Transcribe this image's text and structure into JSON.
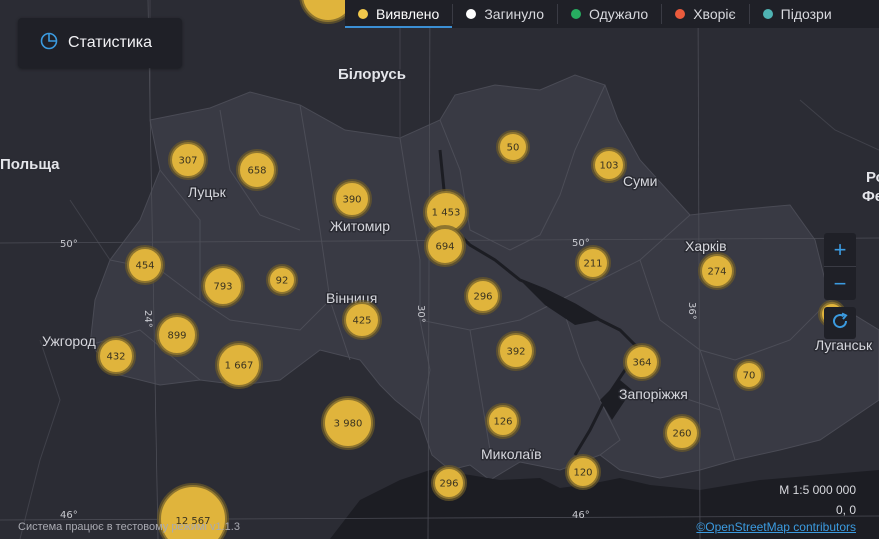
{
  "stats_button": {
    "label": "Статистика",
    "icon": "pie-chart-icon"
  },
  "tabs": [
    {
      "label": "Виявлено",
      "color": "#f2c94c",
      "active": true
    },
    {
      "label": "Загинуло",
      "color": "#ffffff",
      "active": false
    },
    {
      "label": "Одужало",
      "color": "#27ae60",
      "active": false
    },
    {
      "label": "Хворіє",
      "color": "#eb5b3c",
      "active": false
    },
    {
      "label": "Підозри",
      "color": "#4fb3b3",
      "active": false
    }
  ],
  "countries": {
    "belarus": "Білорусь",
    "poland": "Польща",
    "russia_partial_top": "Ро",
    "russia_partial_bottom": "Фе"
  },
  "cities": {
    "lutsk": "Луцьк",
    "zhytomyr": "Житомир",
    "sumy": "Суми",
    "kharkiv": "Харків",
    "vinnytsia": "Вінниця",
    "uzhhorod": "Ужгород",
    "luhansk": "Луганськ",
    "zaporizhzhia": "Запоріжжя",
    "mykolaiv": "Миколаїв"
  },
  "grid_labels": {
    "lat50_left": "50°",
    "lat50_mid": "50°",
    "lat46_left": "46°",
    "lat46_mid": "46°",
    "lon24": "24°",
    "lon30": "30°",
    "lon36": "36°"
  },
  "clusters": [
    {
      "id": "lutsk",
      "value": "307"
    },
    {
      "id": "rivne",
      "value": "658"
    },
    {
      "id": "zhytomyr",
      "value": "390"
    },
    {
      "id": "chernihiv",
      "value": "50"
    },
    {
      "id": "sumy",
      "value": "103"
    },
    {
      "id": "kyiv-city",
      "value": "1 453"
    },
    {
      "id": "kyiv-oblast",
      "value": "694"
    },
    {
      "id": "lviv",
      "value": "454"
    },
    {
      "id": "ternopil",
      "value": "793"
    },
    {
      "id": "khmelnytskyi",
      "value": "92"
    },
    {
      "id": "poltava",
      "value": "211"
    },
    {
      "id": "kharkiv",
      "value": "274"
    },
    {
      "id": "cherkasy",
      "value": "296"
    },
    {
      "id": "vinnytsia",
      "value": "425"
    },
    {
      "id": "ivano-frankivsk",
      "value": "899"
    },
    {
      "id": "uzhhorod",
      "value": "432"
    },
    {
      "id": "chernivtsi",
      "value": "1 667"
    },
    {
      "id": "kirovohrad",
      "value": "392"
    },
    {
      "id": "dnipro",
      "value": "364"
    },
    {
      "id": "donetsk",
      "value": "70"
    },
    {
      "id": "odesa",
      "value": "3 980"
    },
    {
      "id": "mykolaiv",
      "value": "126"
    },
    {
      "id": "zaporizhzhia",
      "value": "260"
    },
    {
      "id": "kherson",
      "value": "120"
    },
    {
      "id": "crimea-west",
      "value": "296"
    },
    {
      "id": "romania",
      "value": "12 567"
    }
  ],
  "scale": "М 1:5 000 000",
  "coords": "0, 0",
  "version": "Система працює в тестовому режимі v1.1.3",
  "attribution": "©OpenStreetMap contributors"
}
